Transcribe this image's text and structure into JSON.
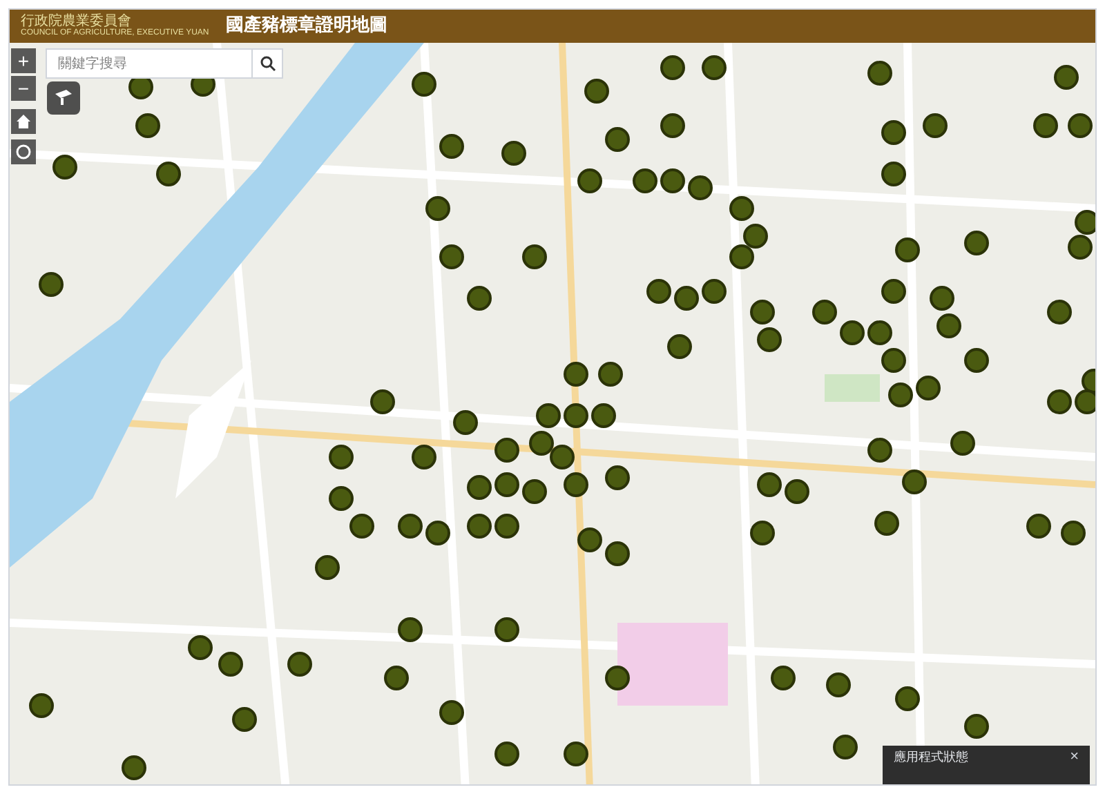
{
  "header": {
    "agency": "行政院農業委員會",
    "agency_en": "COUNCIL OF AGRICULTURE, EXECUTIVE YUAN",
    "title": "國產豬標章證明地圖"
  },
  "search": {
    "placeholder": "關鍵字搜尋"
  },
  "zoom_controls": [
    "+",
    "−"
  ],
  "status_panel": {
    "title": "應用程式狀態",
    "close": "×"
  }
}
